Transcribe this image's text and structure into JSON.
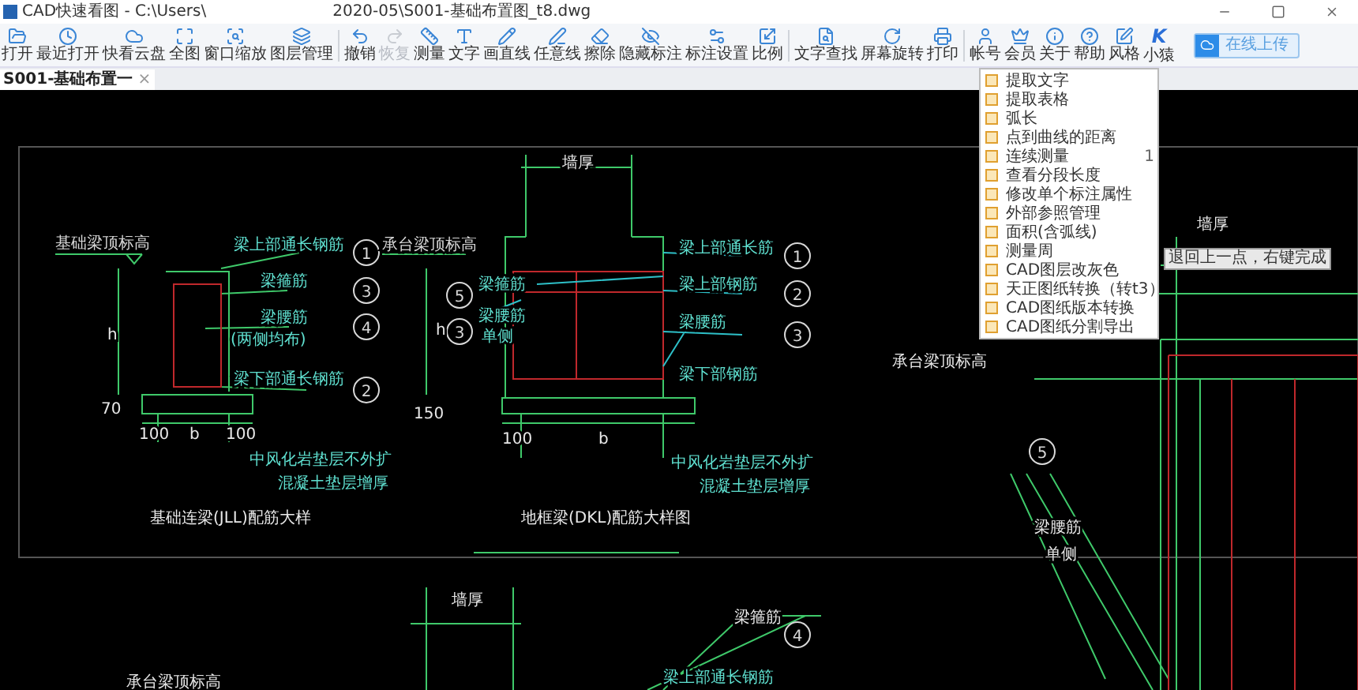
{
  "window": {
    "app_title": "CAD快速看图 - C:\\Users\\",
    "file_path": "2020-05\\S001-基础布置图_t8.dwg"
  },
  "toolbar": [
    [
      {
        "label": "打开",
        "disabled": false
      },
      {
        "label": "最近打开",
        "disabled": false
      },
      {
        "label": "快看云盘",
        "disabled": false
      },
      {
        "label": "全图",
        "disabled": false
      },
      {
        "label": "窗口缩放",
        "disabled": false
      },
      {
        "label": "图层管理",
        "disabled": false
      }
    ],
    [
      {
        "label": "撤销",
        "disabled": false
      },
      {
        "label": "恢复",
        "disabled": true
      },
      {
        "label": "测量",
        "disabled": false
      },
      {
        "label": "文字",
        "disabled": false
      },
      {
        "label": "画直线",
        "disabled": false
      },
      {
        "label": "任意线",
        "disabled": false
      },
      {
        "label": "擦除",
        "disabled": false
      },
      {
        "label": "隐藏标注",
        "disabled": false
      },
      {
        "label": "标注设置",
        "disabled": false
      },
      {
        "label": "比例",
        "disabled": false
      }
    ],
    [
      {
        "label": "文字查找",
        "disabled": false
      },
      {
        "label": "屏幕旋转",
        "disabled": false
      },
      {
        "label": "打印",
        "disabled": false
      }
    ],
    [
      {
        "label": "帐号",
        "disabled": false
      },
      {
        "label": "会员",
        "disabled": false
      },
      {
        "label": "关于",
        "disabled": false
      },
      {
        "label": "帮助",
        "disabled": false
      },
      {
        "label": "风格",
        "disabled": false
      },
      {
        "label": "小猿",
        "disabled": false,
        "glyph": "K"
      }
    ]
  ],
  "upload_button": {
    "label": "在线上传"
  },
  "tabs": [
    {
      "label": "S001-基础布置一",
      "close": "×",
      "selected": true
    }
  ],
  "tools_menu": {
    "items": [
      {
        "label": "提取文字"
      },
      {
        "label": "提取表格"
      },
      {
        "label": "弧长"
      },
      {
        "label": "点到曲线的距离"
      },
      {
        "label": "连续测量",
        "shortcut": "1"
      },
      {
        "label": "查看分段长度"
      },
      {
        "label": "修改单个标注属性"
      },
      {
        "label": "外部参照管理"
      },
      {
        "label": "面积(含弧线)"
      },
      {
        "label": "测量周"
      },
      {
        "label": "CAD图层改灰色"
      },
      {
        "label": "天正图纸转换（转t3）"
      },
      {
        "label": "CAD图纸版本转换"
      },
      {
        "label": "CAD图纸分割导出"
      }
    ]
  },
  "tooltip": "退回上一点，右键完成",
  "drawing": {
    "labels": [
      "基础梁顶标高",
      "梁上部通长钢筋",
      "梁箍筋",
      "梁腰筋",
      "(两侧均布)",
      "梁下部通长钢筋",
      "h",
      "70",
      "100",
      "b",
      "100",
      "中风化岩垫层不外扩",
      "混凝土垫层增厚",
      "基础连梁(JLL)配筋大样",
      "墙厚",
      "承台梁顶标高",
      "梁箍筋",
      "梁腰筋",
      "单侧",
      "梁上部通长筋",
      "梁上部钢筋",
      "梁腰筋",
      "梁下部钢筋",
      "h",
      "150",
      "100",
      "b",
      "中风化岩垫层不外扩",
      "混凝土垫层增厚",
      "地框梁(DKL)配筋大样图",
      "墙厚",
      "承台梁顶标高",
      "梁腰筋",
      "单侧",
      "墙厚",
      "梁箍筋",
      "承台梁顶标高",
      "梁上部通长钢筋"
    ],
    "markers": [
      "1",
      "3",
      "4",
      "2",
      "5",
      "3",
      "1",
      "2",
      "3",
      "5",
      "4"
    ]
  }
}
